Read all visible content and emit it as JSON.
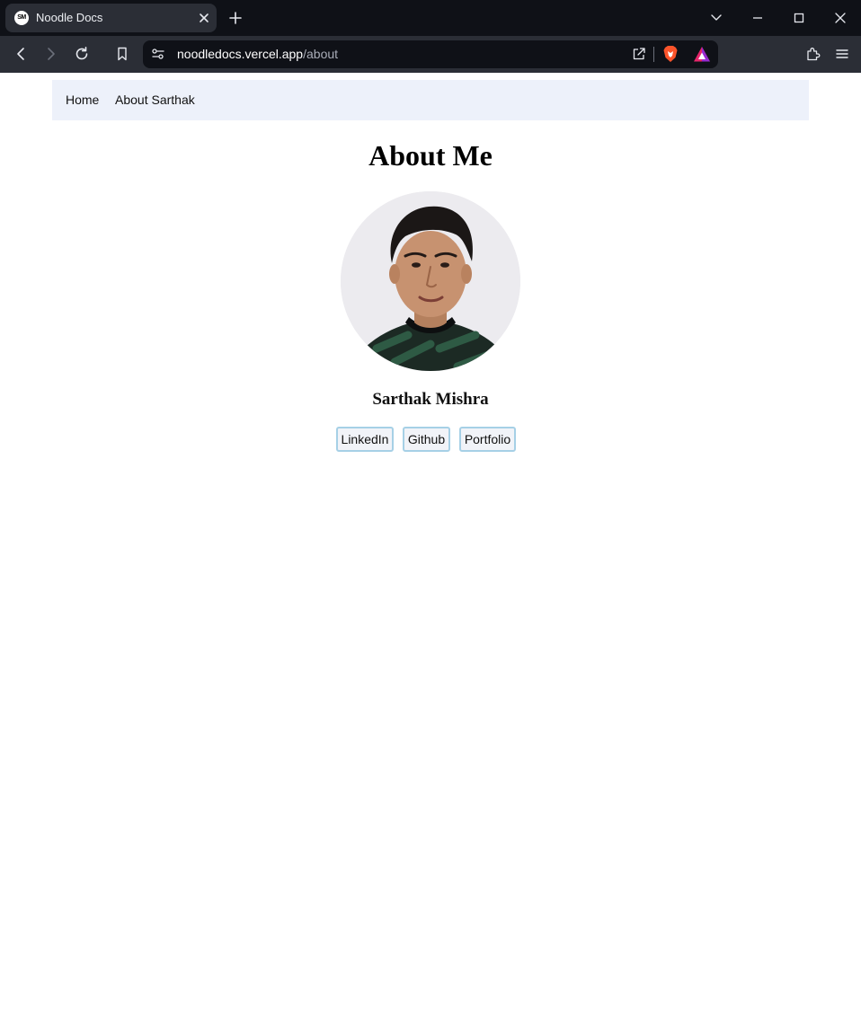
{
  "browser": {
    "tab": {
      "title": "Noodle Docs",
      "favicon_text": "SM"
    },
    "url": {
      "host": "noodledocs.vercel.app",
      "path": "/about"
    }
  },
  "nav": {
    "items": [
      {
        "label": "Home"
      },
      {
        "label": "About Sarthak"
      }
    ]
  },
  "main": {
    "title": "About Me",
    "name": "Sarthak Mishra",
    "links": [
      {
        "label": "LinkedIn"
      },
      {
        "label": "Github"
      },
      {
        "label": "Portfolio"
      }
    ]
  },
  "colors": {
    "tabbar_bg": "#0f1117",
    "toolbar_bg": "#2b2e36",
    "nav_bg": "#edf1fa",
    "button_border": "#a6d0e6"
  }
}
